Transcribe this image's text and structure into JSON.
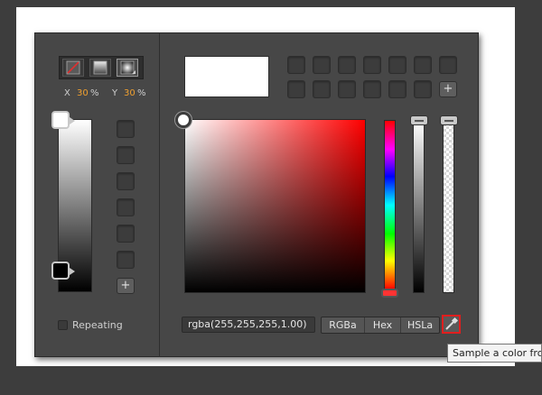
{
  "gradient_type": {
    "options": [
      {
        "name": "none-fill-icon"
      },
      {
        "name": "linear-gradient-icon"
      },
      {
        "name": "radial-gradient-icon"
      }
    ],
    "selected": "radial-gradient-icon"
  },
  "position": {
    "x_label": "X",
    "x_value": "30",
    "y_label": "Y",
    "y_value": "30",
    "unit": "%"
  },
  "gradient_stops": {
    "start_color": "#ffffff",
    "end_color": "#000000"
  },
  "swatch_column": {
    "count": 6
  },
  "swatch_grid": {
    "rows": 2,
    "cols": 7
  },
  "add_symbol": "+",
  "preview_color": "#ffffff",
  "picker": {
    "hue": "#ff0000",
    "luminance_track": [
      "#ffffff",
      "#000000"
    ]
  },
  "color_value": "rgba(255,255,255,1.00)",
  "modes": [
    "RGBa",
    "Hex",
    "HSLa"
  ],
  "repeating_label": "Repeating",
  "repeating_checked": false,
  "eyedropper_tooltip": "Sample a color from",
  "colors": {
    "accent": "#f0a030",
    "eyedropper_border": "#e01e1e",
    "panel_bg": "#474747"
  }
}
